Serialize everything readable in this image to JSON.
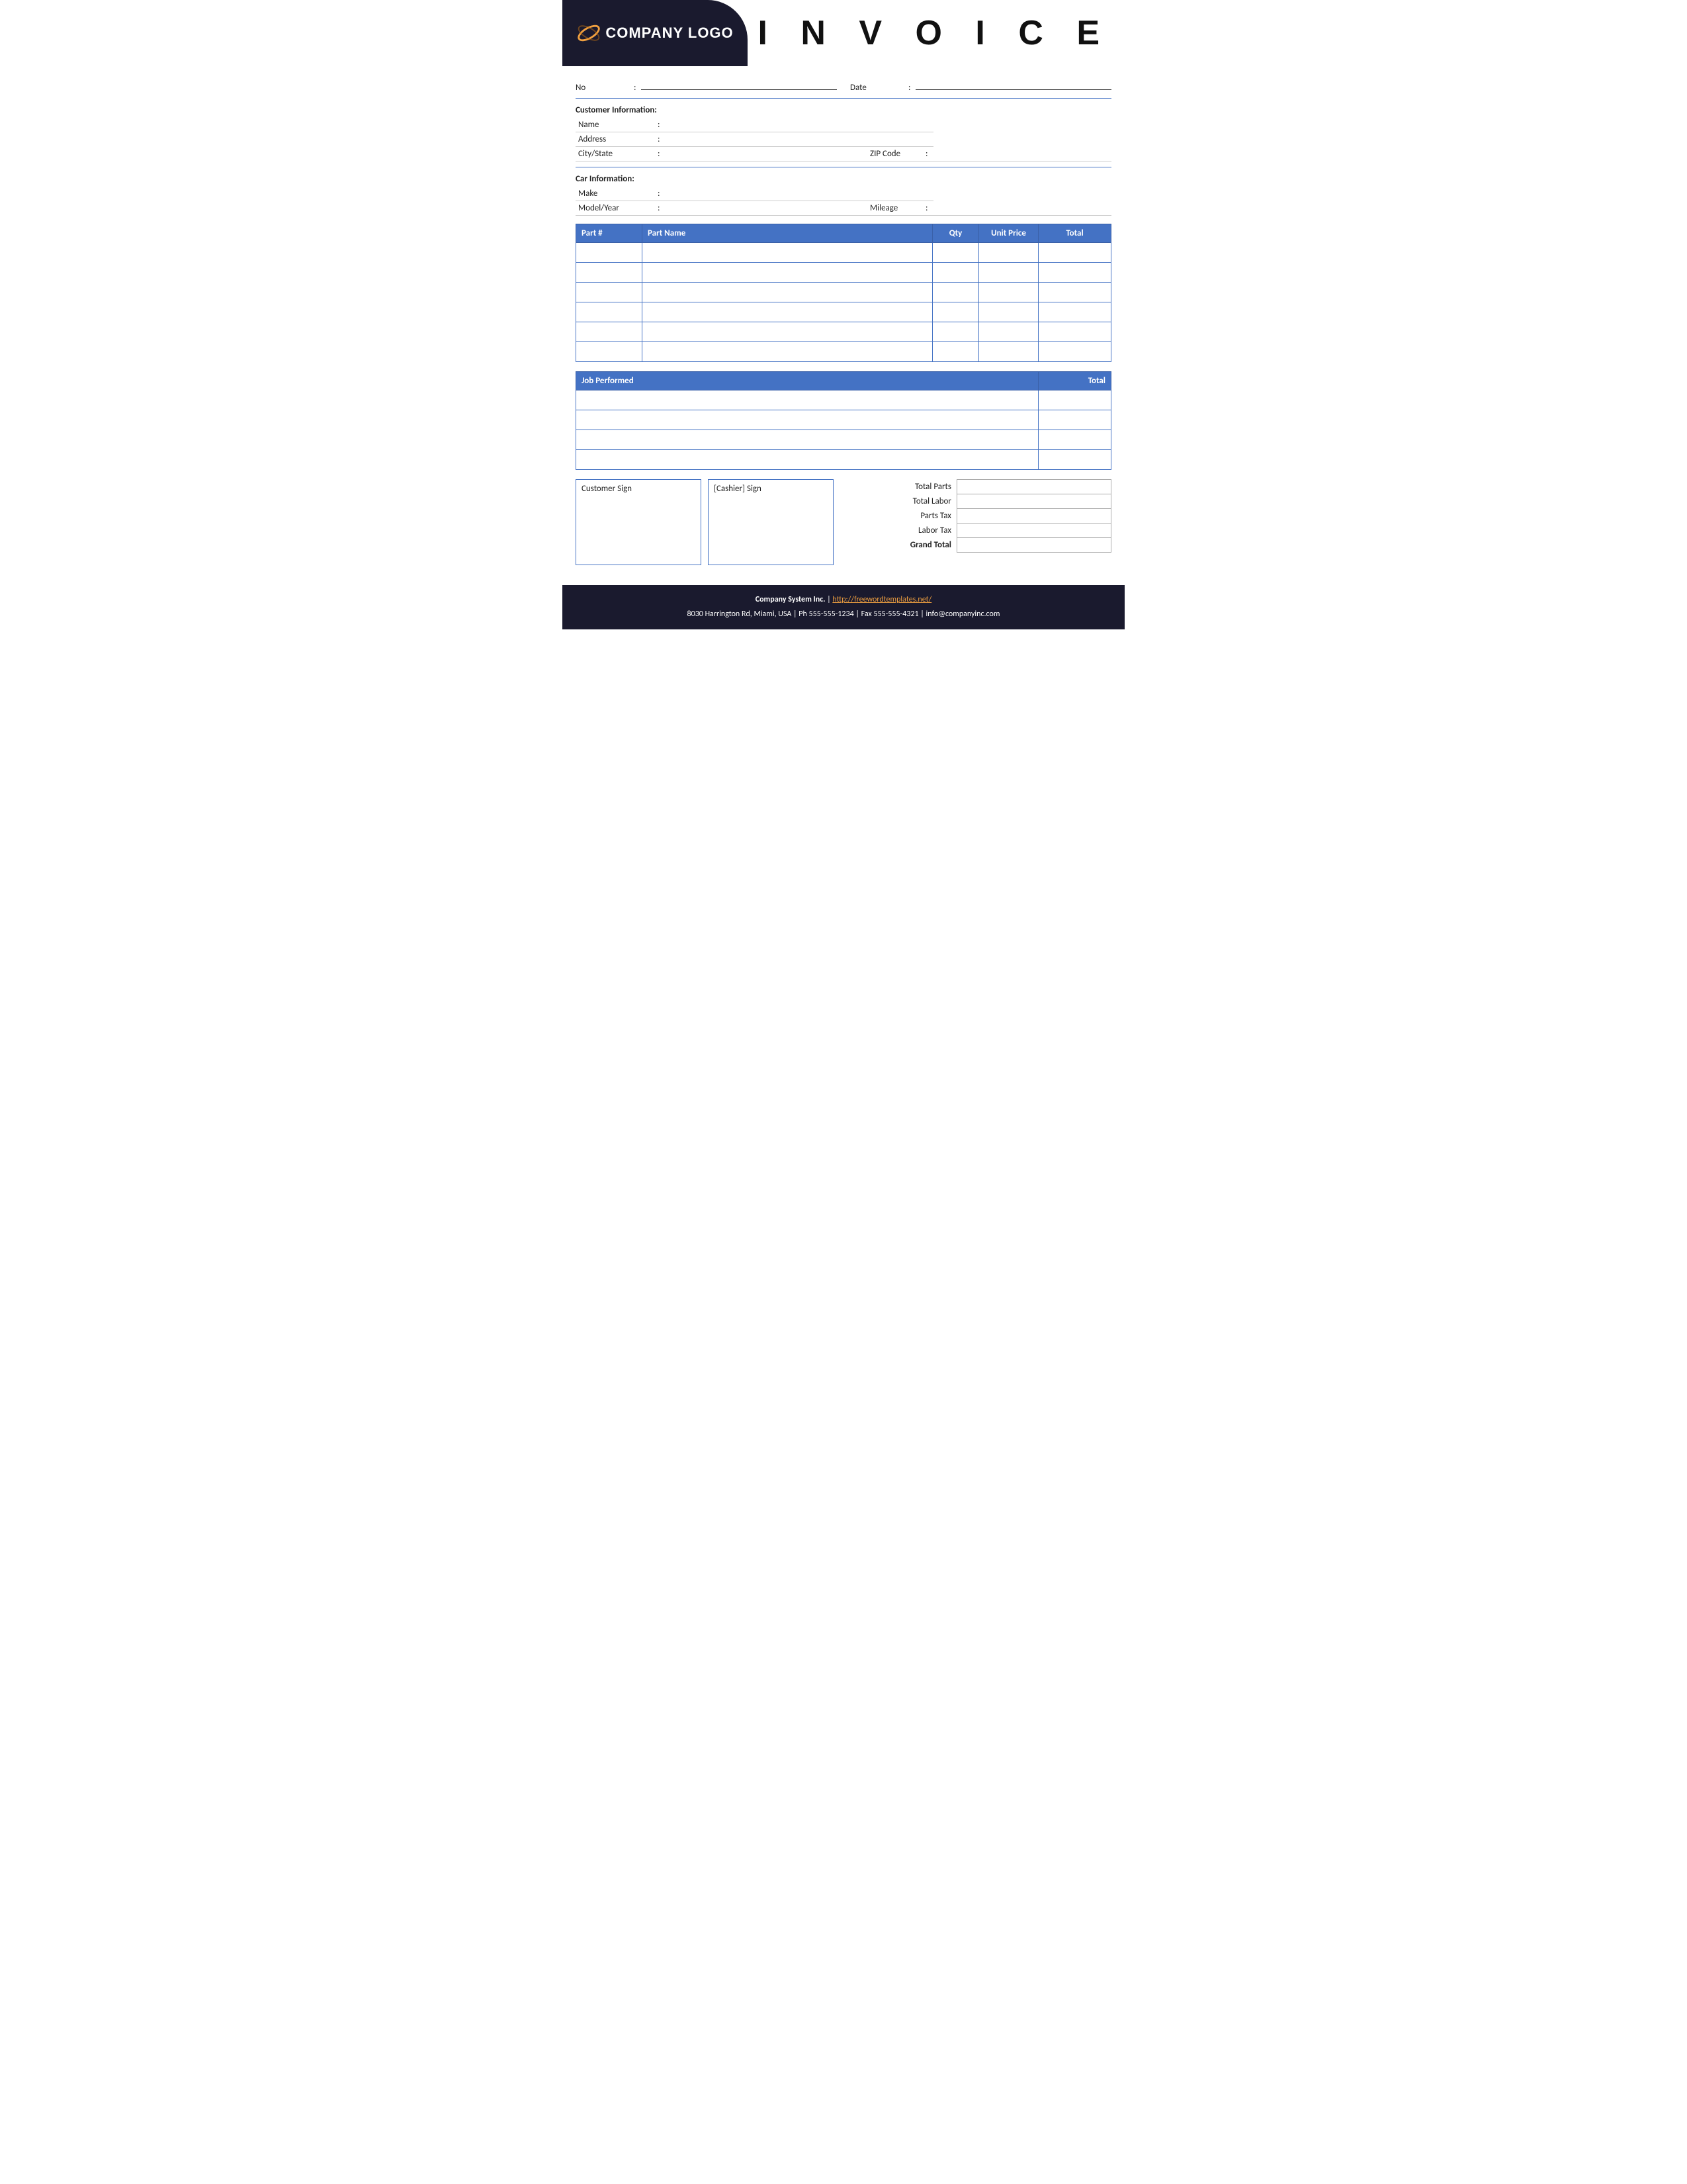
{
  "header": {
    "logo_text": "COMPANY LOGO",
    "title": "I N V O I C E"
  },
  "invoice": {
    "no_label": "No",
    "date_label": "Date",
    "colon": ":"
  },
  "customer": {
    "section_title": "Customer Information:",
    "name_label": "Name",
    "address_label": "Address",
    "city_state_label": "City/State",
    "zip_label": "ZIP Code"
  },
  "car": {
    "section_title": "Car Information:",
    "make_label": "Make",
    "model_year_label": "Model/Year",
    "mileage_label": "Mileage"
  },
  "parts_table": {
    "headers": [
      "Part #",
      "Part Name",
      "Qty",
      "Unit Price",
      "Total"
    ],
    "rows": [
      {
        "part_num": "",
        "part_name": "",
        "qty": "",
        "unit_price": "",
        "total": ""
      },
      {
        "part_num": "",
        "part_name": "",
        "qty": "",
        "unit_price": "",
        "total": ""
      },
      {
        "part_num": "",
        "part_name": "",
        "qty": "",
        "unit_price": "",
        "total": ""
      },
      {
        "part_num": "",
        "part_name": "",
        "qty": "",
        "unit_price": "",
        "total": ""
      },
      {
        "part_num": "",
        "part_name": "",
        "qty": "",
        "unit_price": "",
        "total": ""
      },
      {
        "part_num": "",
        "part_name": "",
        "qty": "",
        "unit_price": "",
        "total": ""
      }
    ]
  },
  "job_table": {
    "headers": [
      "Job Performed",
      "Total"
    ],
    "rows": [
      {
        "job": "",
        "total": ""
      },
      {
        "job": "",
        "total": ""
      },
      {
        "job": "",
        "total": ""
      },
      {
        "job": "",
        "total": ""
      }
    ]
  },
  "signatures": {
    "customer_sign": "Customer Sign",
    "cashier_sign": "[Cashier] Sign"
  },
  "totals": {
    "total_parts_label": "Total Parts",
    "total_labor_label": "Total Labor",
    "parts_tax_label": "Parts Tax",
    "labor_tax_label": "Labor Tax",
    "grand_total_label": "Grand Total"
  },
  "footer": {
    "company_name": "Company System Inc.",
    "separator": " | ",
    "website": "http://freewordtemplates.net/",
    "address_line": "8030 Harrington Rd, Miami, USA | Ph 555-555-1234 | Fax 555-555-4321 | info@companyinc.com"
  }
}
